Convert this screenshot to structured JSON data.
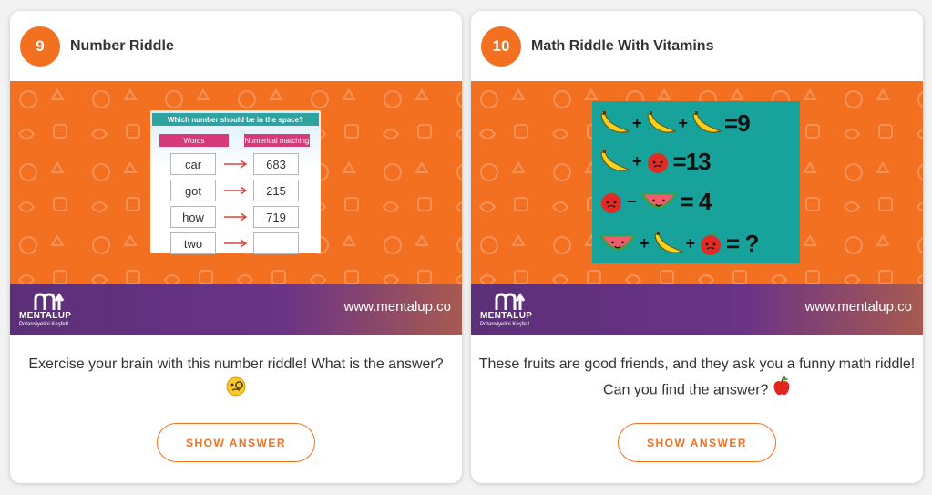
{
  "cards": [
    {
      "number": "9",
      "title": "Number Riddle",
      "puzzle": {
        "question": "Which number should be in the space?",
        "col_words": "Words",
        "col_numbers": "Numerical matching",
        "rows": [
          {
            "word": "car",
            "number": "683"
          },
          {
            "word": "got",
            "number": "215"
          },
          {
            "word": "how",
            "number": "719"
          },
          {
            "word": "two",
            "number": ""
          }
        ]
      },
      "logo_text": "MENTALUP",
      "logo_sub": "Potansiyelini Keşfet!",
      "site": "www.mentalup.co",
      "description": "Exercise your brain with this number riddle! What is the answer?",
      "emoji": "monocle-face-emoji",
      "button": "SHOW ANSWER"
    },
    {
      "number": "10",
      "title": "Math Riddle With Vitamins",
      "puzzle": {
        "eq1": "=9",
        "eq2": "=13",
        "eq3": "= 4",
        "eq4": "= ?"
      },
      "logo_text": "MENTALUP",
      "logo_sub": "Potansiyelini Keşfet!",
      "site": "www.mentalup.co",
      "description": "These fruits are good friends, and they ask you a funny math riddle! Can you find the answer?",
      "emoji": "red-apple-emoji",
      "button": "SHOW ANSWER"
    }
  ],
  "colors": {
    "accent": "#f37021",
    "purple": "#5c2f78",
    "teal": "#17a39b"
  }
}
